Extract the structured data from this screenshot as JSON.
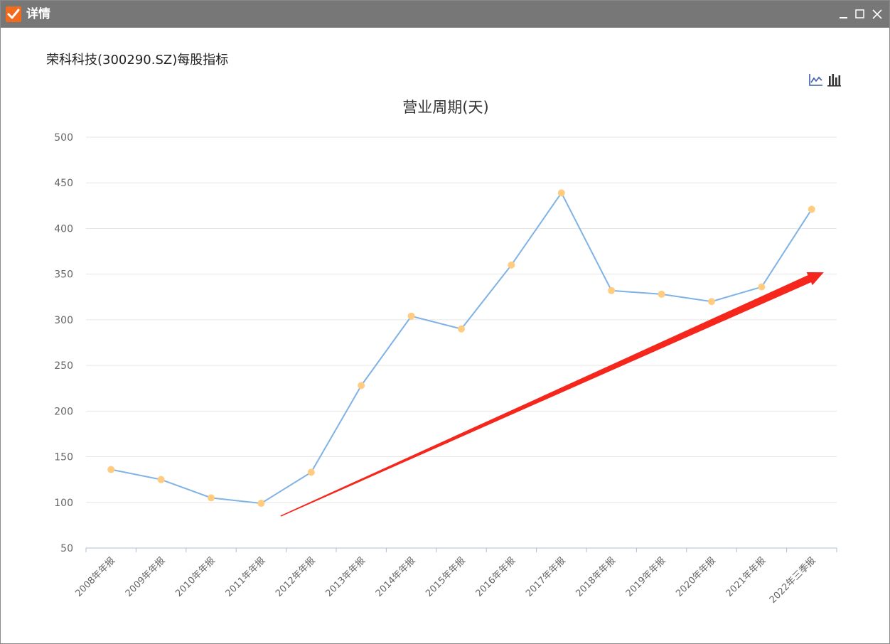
{
  "window": {
    "title": "详情"
  },
  "page": {
    "heading": "荣科科技(300290.SZ)每股指标"
  },
  "toolbar": {
    "line_icon": "line-chart-icon",
    "bar_icon": "bar-chart-icon"
  },
  "colors": {
    "titlebar": "#777777",
    "app_icon": "#f26b1d",
    "line": "#7fb2e5",
    "point": "#ffcc80",
    "arrow": "#f5261c",
    "grid": "#e6e6e6"
  },
  "chart_data": {
    "type": "line",
    "title": "营业周期(天)",
    "xlabel": "",
    "ylabel": "",
    "ylim": [
      50,
      500
    ],
    "yticks": [
      50,
      100,
      150,
      200,
      250,
      300,
      350,
      400,
      450,
      500
    ],
    "grid": true,
    "categories": [
      "2008年年报",
      "2009年年报",
      "2010年年报",
      "2011年年报",
      "2012年年报",
      "2013年年报",
      "2014年年报",
      "2015年年报",
      "2016年年报",
      "2017年年报",
      "2018年年报",
      "2019年年报",
      "2020年年报",
      "2021年年报",
      "2022年三季报"
    ],
    "series": [
      {
        "values": [
          136,
          125,
          105,
          99,
          133,
          228,
          304,
          290,
          360,
          439,
          332,
          328,
          320,
          336,
          421
        ]
      }
    ],
    "annotations": [
      {
        "type": "arrow",
        "from": {
          "category": "2012年年报",
          "value": 85
        },
        "to": {
          "category": "2022年三季报",
          "value": 352
        }
      }
    ]
  }
}
